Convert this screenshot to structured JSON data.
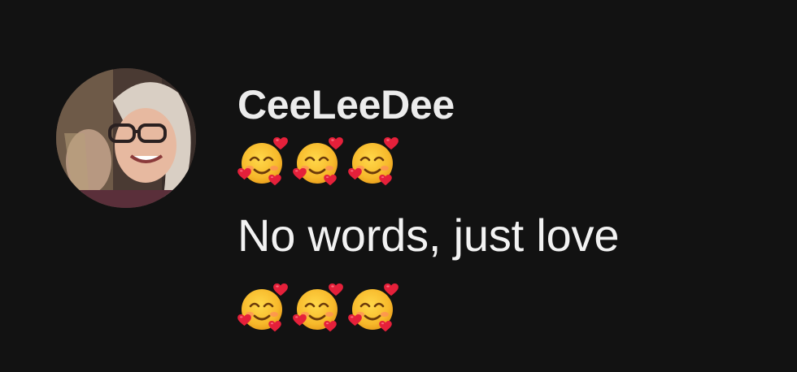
{
  "comment": {
    "username": "CeeLeeDee",
    "emoji_line_1": [
      "smiling-face-with-hearts",
      "smiling-face-with-hearts",
      "smiling-face-with-hearts"
    ],
    "message": "No words, just love",
    "emoji_line_2": [
      "smiling-face-with-hearts",
      "smiling-face-with-hearts",
      "smiling-face-with-hearts"
    ]
  },
  "colors": {
    "background": "#121212",
    "text": "#f2f2f2",
    "emoji_face": "#f7b92b",
    "emoji_heart": "#e5203a"
  }
}
